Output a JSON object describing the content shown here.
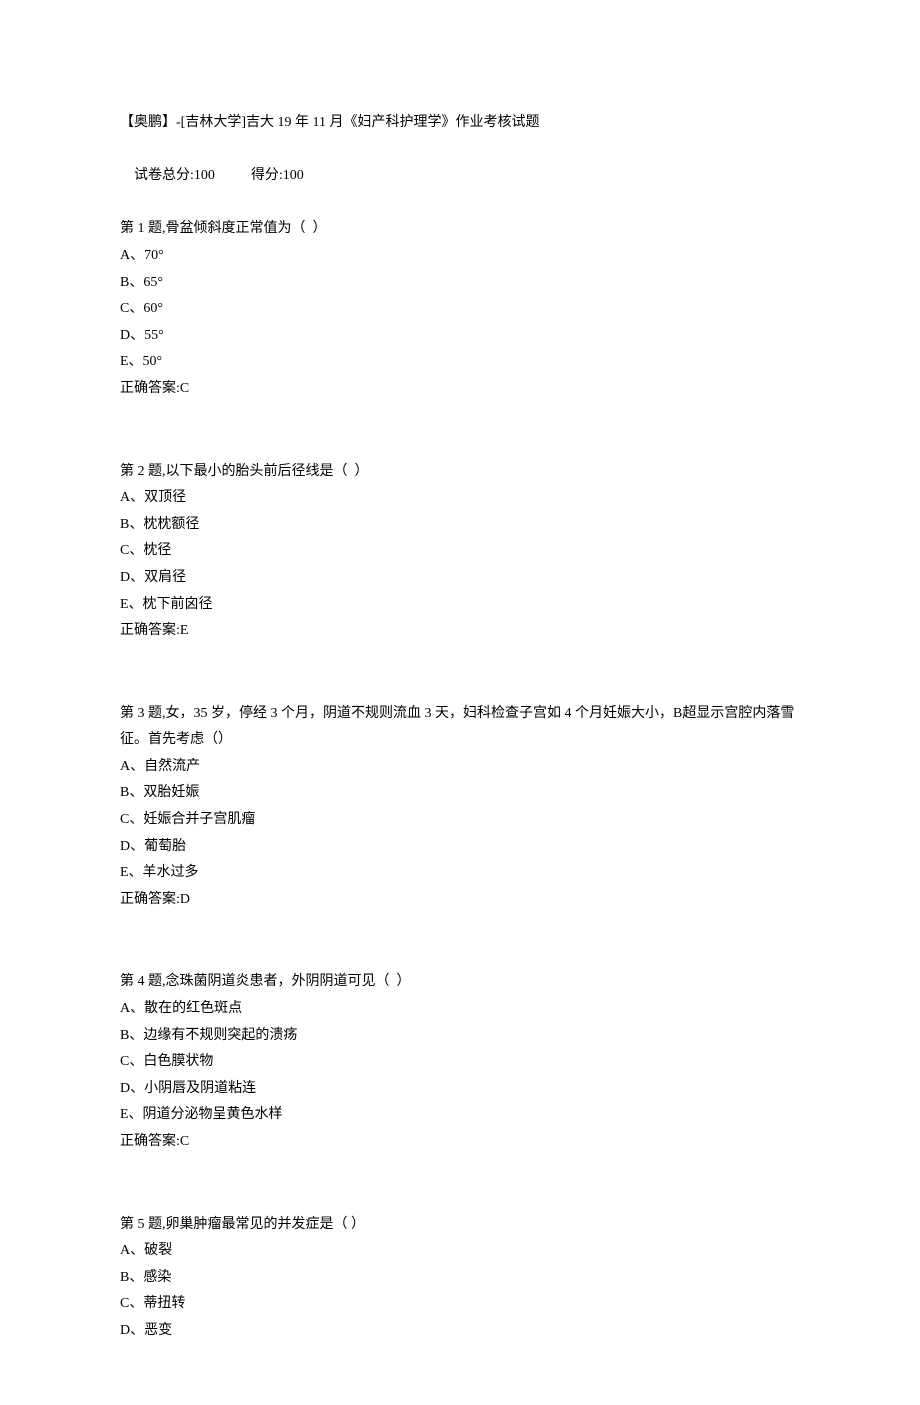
{
  "header": {
    "title": "【奥鹏】-[吉林大学]吉大 19 年 11 月《妇产科护理学》作业考核试题",
    "score_total_label": "试卷总分:",
    "score_total_value": "100",
    "score_got_label": "得分:",
    "score_got_value": "100"
  },
  "answer_label_prefix": "正确答案:",
  "questions": [
    {
      "prompt": "第 1 题,骨盆倾斜度正常值为（  ）",
      "options": [
        "A、70°",
        "B、65°",
        "C、60°",
        "D、55°",
        "E、50°"
      ],
      "answer": "C"
    },
    {
      "prompt": "第 2 题,以下最小的胎头前后径线是（  ）",
      "options": [
        "A、双顶径",
        "B、枕枕额径",
        "C、枕径",
        "D、双肩径",
        "E、枕下前囟径"
      ],
      "answer": "E"
    },
    {
      "prompt": "第 3 题,女，35 岁，停经 3 个月，阴道不规则流血 3 天，妇科检查子宫如 4 个月妊娠大小，B超显示宫腔内落雪征。首先考虑（）",
      "options": [
        "A、自然流产",
        "B、双胎妊娠",
        "C、妊娠合并子宫肌瘤",
        "D、葡萄胎",
        "E、羊水过多"
      ],
      "answer": "D"
    },
    {
      "prompt": "第 4 题,念珠菌阴道炎患者，外阴阴道可见（  ）",
      "options": [
        "A、散在的红色斑点",
        "B、边缘有不规则突起的溃疡",
        "C、白色膜状物",
        "D、小阴唇及阴道粘连",
        "E、阴道分泌物呈黄色水样"
      ],
      "answer": "C"
    },
    {
      "prompt": "第 5 题,卵巢肿瘤最常见的并发症是（ ）",
      "options": [
        "A、破裂",
        "B、感染",
        "C、蒂扭转",
        "D、恶变"
      ],
      "answer": ""
    }
  ]
}
